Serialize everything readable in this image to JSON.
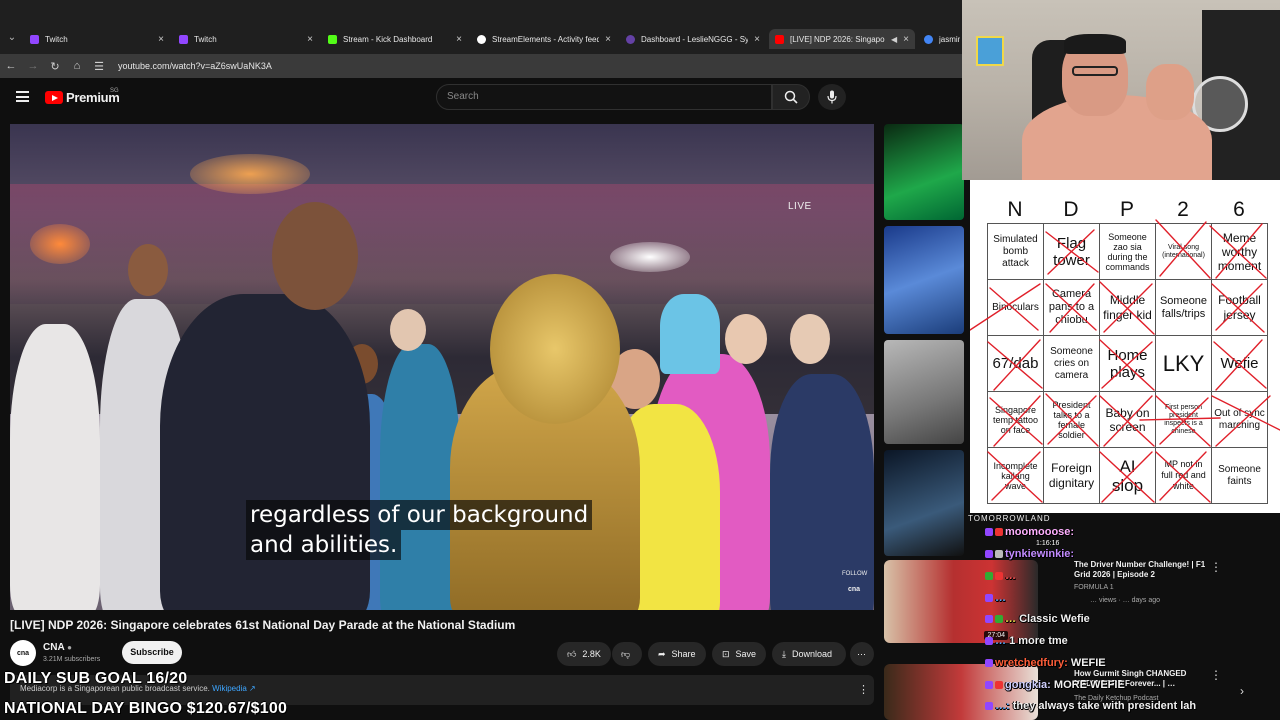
{
  "browser": {
    "tabs": [
      {
        "title": "Twitch",
        "color": "#9146ff"
      },
      {
        "title": "Twitch",
        "color": "#9146ff"
      },
      {
        "title": "Stream - Kick Dashboard",
        "color": "#53fc18"
      },
      {
        "title": "StreamElements - Activity feed",
        "color": "#ffffff"
      },
      {
        "title": "Dashboard - LeslieNGGG - Syn",
        "color": "#6441a5"
      },
      {
        "title": "[LIVE] NDP 2026: Singapore",
        "color": "#ff0000"
      },
      {
        "title": "jasmine",
        "color": "#4285f4"
      }
    ],
    "url": "youtube.com/watch?v=aZ6swUaNK3A"
  },
  "youtube": {
    "brand": "Premium",
    "region": "SG",
    "search_placeholder": "Search"
  },
  "video": {
    "live_label": "LIVE",
    "subtitle_line1": "regardless of our background",
    "subtitle_line2": "and abilities.",
    "follow_label": "FOLLOW",
    "bug_label": "cna",
    "title": "[LIVE] NDP 2026: Singapore celebrates 61st National Day Parade at the National Stadium",
    "channel": "CNA",
    "channel_avatar": "cna",
    "subscribers": "3.21M subscribers",
    "subscribe_label": "Subscribe",
    "likes": "2.8K",
    "share_label": "Share",
    "save_label": "Save",
    "download_label": "Download",
    "description": "Mediacorp is a Singaporean public broadcast service.",
    "description_link": "Wikipedia ↗"
  },
  "overlays": {
    "sub_goal": "DAILY SUB GOAL 16/20",
    "bingo_goal": "NATIONAL DAY BINGO $120.67/$100"
  },
  "sidebar": {
    "recommendations": [
      {
        "title": "The Driver Number Challenge! | F1 Grid 2026 | Episode 2",
        "channel": "FORMULA 1",
        "meta": "… views · … days ago",
        "duration": "27:04"
      },
      {
        "title": "How Gurmit Singh CHANGED MEDIACORP Forever... | …",
        "channel": "The Daily Ketchup Podcast",
        "meta": "",
        "duration": ""
      }
    ],
    "tomorrowland": "TOMORROWLAND",
    "duration_1": "1:16:16"
  },
  "bingo": {
    "header": [
      "N",
      "D",
      "P",
      "2",
      "6"
    ],
    "cells": [
      [
        "Simulated bomb attack",
        "Flag tower",
        "Someone zao sia during the commands",
        "Viral song (international)",
        "Meme worthy moment"
      ],
      [
        "Binoculars",
        "Camera pans to a chiobu",
        "Middle finger kid",
        "Someone falls/trips",
        "Football jersey"
      ],
      [
        "67/dab",
        "Someone cries on camera",
        "Home plays",
        "LKY",
        "Wefie"
      ],
      [
        "Singapore temp tattoo on face",
        "President talks to a female soldier",
        "Baby on screen",
        "First person president inspects is a chinese",
        "Out of sync marching"
      ],
      [
        "Incomplete kallang wave",
        "Foreign dignitary",
        "AI slop",
        "MP not in full red and white",
        "Someone faints"
      ]
    ]
  },
  "chat": [
    {
      "user": "moomooose:",
      "msg": "",
      "color": "#ffb0ff"
    },
    {
      "user": "tynkiewinkie:",
      "msg": "",
      "color": "#c28bff"
    },
    {
      "user": "…",
      "msg": "",
      "color": "#ff5555"
    },
    {
      "user": "…",
      "msg": "",
      "color": "#4fa8ff"
    },
    {
      "user": "…",
      "msg": "Classic Wefie",
      "color": "#ffffff"
    },
    {
      "user": "…",
      "msg": "1 more tme",
      "color": "#4fa8ff"
    },
    {
      "user": "wretchedfury:",
      "msg": "WEFIE",
      "color": "#ff5e3a"
    },
    {
      "user": "gongkia:",
      "msg": "MORE WEFIE",
      "color": "#d0d0ff"
    },
    {
      "user": "…:",
      "msg": "they always take with president lah",
      "color": "#4fa8ff"
    }
  ]
}
